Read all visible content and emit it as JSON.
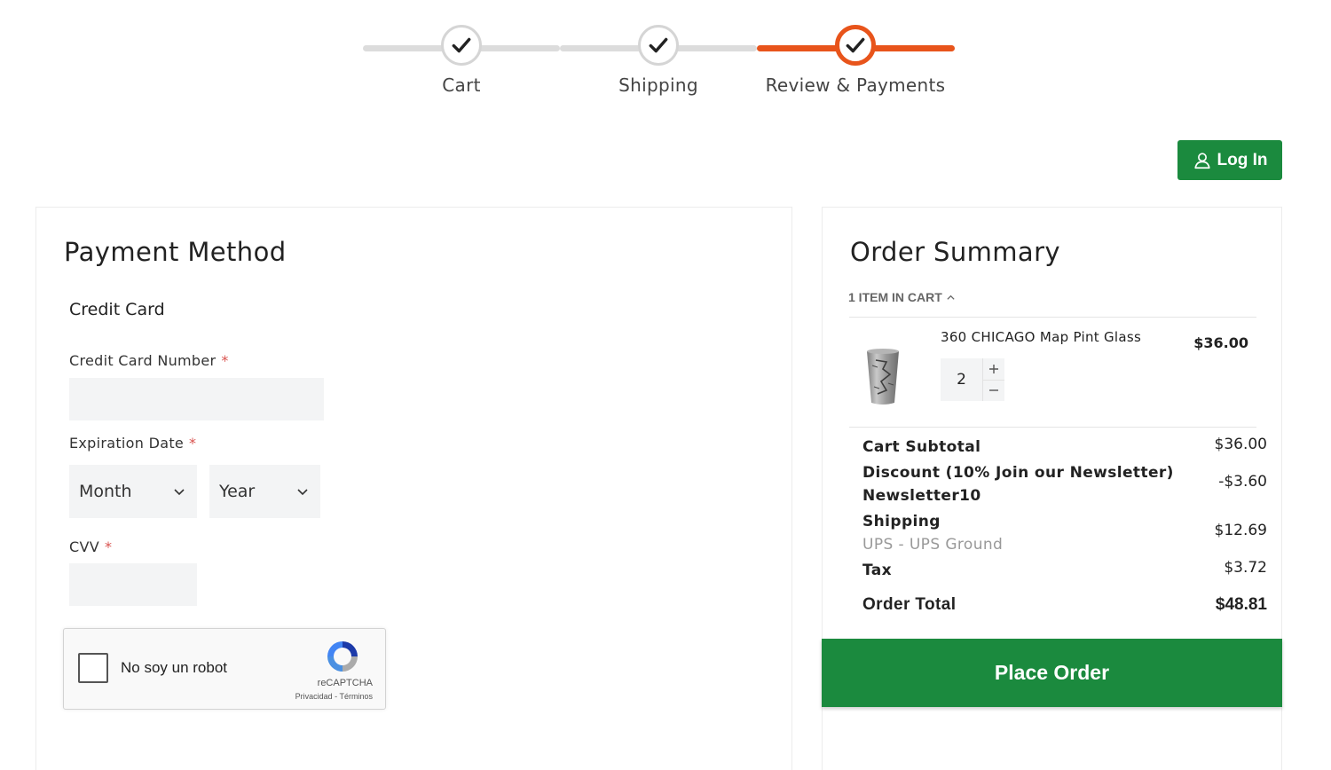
{
  "steps": [
    {
      "label": "Cart",
      "completed": true
    },
    {
      "label": "Shipping",
      "completed": true
    },
    {
      "label": "Review & Payments",
      "completed": true,
      "active": true
    }
  ],
  "header": {
    "login_label": "Log In"
  },
  "payment": {
    "title": "Payment Method",
    "method_label": "Credit Card",
    "card_number_label": "Credit Card Number",
    "expiration_label": "Expiration Date",
    "month_select": "Month",
    "year_select": "Year",
    "cvv_label": "CVV",
    "required_mark": "*",
    "captcha": {
      "label": "No soy un robot",
      "brand": "reCAPTCHA",
      "links": "Privacidad - Términos"
    }
  },
  "summary": {
    "title": "Order Summary",
    "items_toggle": "1 ITEM IN CART",
    "items": [
      {
        "name": "360 CHICAGO Map Pint Glass",
        "price": "$36.00",
        "qty": "2"
      }
    ],
    "totals": {
      "subtotal_label": "Cart Subtotal",
      "subtotal_value": "$36.00",
      "discount_label": "Discount (10% Join our Newsletter)",
      "discount_code": "Newsletter10",
      "discount_value": "-$3.60",
      "shipping_label": "Shipping",
      "shipping_method": "UPS - UPS Ground",
      "shipping_value": "$12.69",
      "tax_label": "Tax",
      "tax_value": "$3.72",
      "order_total_label": "Order Total",
      "order_total_value": "$48.81"
    },
    "place_order_label": "Place Order"
  },
  "colors": {
    "accent_orange": "#e8541b",
    "brand_green": "#1b8a3e",
    "step_grey": "#dcdcdc",
    "required_red": "#d9534f"
  }
}
